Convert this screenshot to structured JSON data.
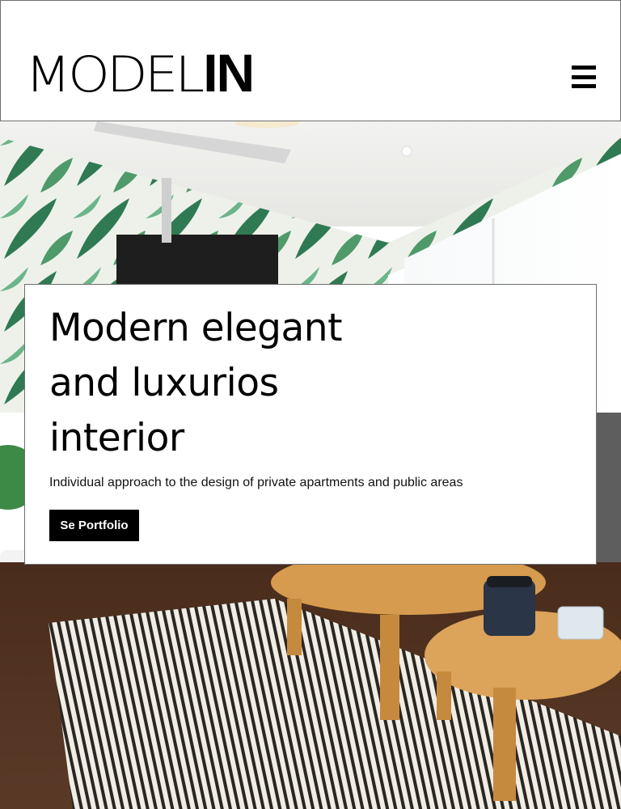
{
  "header": {
    "logo_thin": "MODEL",
    "logo_bold": "IN"
  },
  "hero": {
    "title": "Modern elegant\nand luxurios\ninterior",
    "subtitle": "Individual approach to the design of private apartments and public areas",
    "cta_label": "Se Portfolio"
  },
  "icons": {
    "menu": "hamburger-menu-icon"
  },
  "colors": {
    "text": "#000000",
    "button_bg": "#000000",
    "button_text": "#ffffff",
    "border": "#6f6f6f"
  }
}
